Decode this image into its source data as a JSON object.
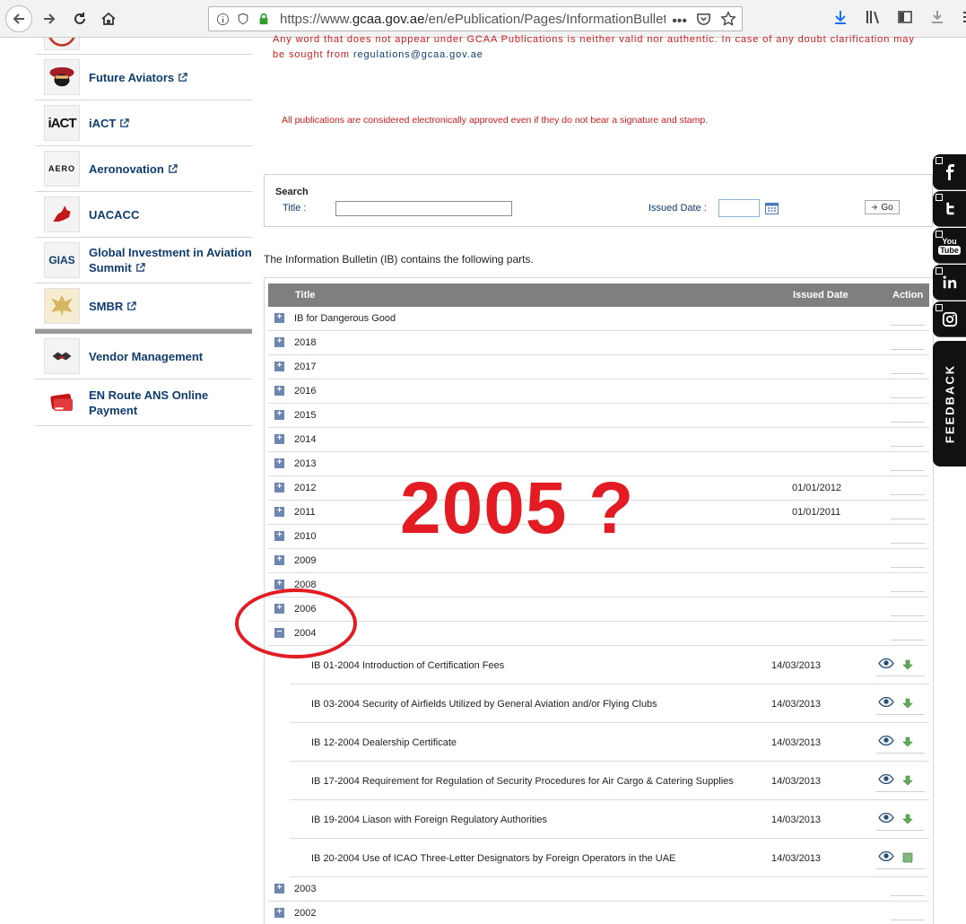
{
  "browser": {
    "url_prefix": "https://www.",
    "url_domain": "gcaa.gov.ae",
    "url_path": "/en/ePublication/Pages/InformationBulletin.as",
    "more_label": "•••"
  },
  "sidebar": {
    "items": [
      {
        "label": "Future Aviators",
        "external": true
      },
      {
        "label": "iACT",
        "external": true
      },
      {
        "label": "Aeronovation",
        "external": true
      },
      {
        "label": "UACACC",
        "external": false
      },
      {
        "label": "Global Investment in Aviation Summit",
        "external": true
      },
      {
        "label": "SMBR",
        "external": true
      }
    ],
    "items2": [
      {
        "label": "Vendor Management"
      },
      {
        "label": "EN Route ANS Online Payment"
      }
    ],
    "logos": {
      "iact": "iACT",
      "aero": "AERO",
      "gias": "GIAS"
    }
  },
  "notice": {
    "line1": "Any word that does not appear under GCAA Publications is neither valid nor authentic. In case of any doubt clarification may be sought from ",
    "email": "regulations@gcaa.gov.ae",
    "line2": "All publications are considered electronically approved even if they do not bear a signature and stamp."
  },
  "search": {
    "heading": "Search",
    "title_label": "Title :",
    "title_value": "",
    "date_label": "Issued Date :",
    "date_value": "",
    "go_label": "Go"
  },
  "intro": "The Information Bulletin (IB) contains the following parts.",
  "table": {
    "headers": {
      "title": "Title",
      "issued": "Issued Date",
      "action": "Action"
    },
    "years_top": [
      {
        "label": "IB for Dangerous Good",
        "date": ""
      },
      {
        "label": "2018",
        "date": ""
      },
      {
        "label": "2017",
        "date": ""
      },
      {
        "label": "2016",
        "date": ""
      },
      {
        "label": "2015",
        "date": ""
      },
      {
        "label": "2014",
        "date": ""
      },
      {
        "label": "2013",
        "date": ""
      },
      {
        "label": "2012",
        "date": "01/01/2012"
      },
      {
        "label": "2011",
        "date": "01/01/2011"
      },
      {
        "label": "2010",
        "date": ""
      },
      {
        "label": "2009",
        "date": ""
      },
      {
        "label": "2008",
        "date": ""
      },
      {
        "label": "2006",
        "date": ""
      },
      {
        "label": "2004",
        "date": "",
        "expanded": true
      }
    ],
    "docs_2004": [
      {
        "title": "IB 01-2004 Introduction of Certification Fees",
        "date": "14/03/2013"
      },
      {
        "title": "IB 03-2004 Security of Airfields Utilized by General Aviation and/or Flying Clubs",
        "date": "14/03/2013"
      },
      {
        "title": "IB 12-2004 Dealership Certificate",
        "date": "14/03/2013"
      },
      {
        "title": "IB 17-2004 Requirement for Regulation of Security Procedures for Air Cargo & Catering Supplies",
        "date": "14/03/2013"
      },
      {
        "title": "IB 19-2004 Liason with Foreign Regulatory Authorities",
        "date": "14/03/2013"
      },
      {
        "title": "IB 20-2004 Use of ICAO Three-Letter Designators by Foreign Operators in the UAE",
        "date": "14/03/2013"
      }
    ],
    "years_bottom": [
      {
        "label": "2003",
        "date": ""
      },
      {
        "label": "2002",
        "date": ""
      }
    ]
  },
  "annotation": {
    "text": "2005 ?",
    "color": "#e31b22"
  },
  "social": {
    "items": [
      "facebook-icon",
      "twitter-icon",
      "youtube-icon",
      "linkedin-icon",
      "instagram-icon"
    ],
    "youtube_top": "You",
    "youtube_bottom": "Tube",
    "feedback_label": "FEEDBACK"
  },
  "colors": {
    "header_bg": "#7f7f7f",
    "toggle_blue": "#6d87b2",
    "notice_red": "#d21b1b",
    "link_navy": "#0f3c6e"
  }
}
